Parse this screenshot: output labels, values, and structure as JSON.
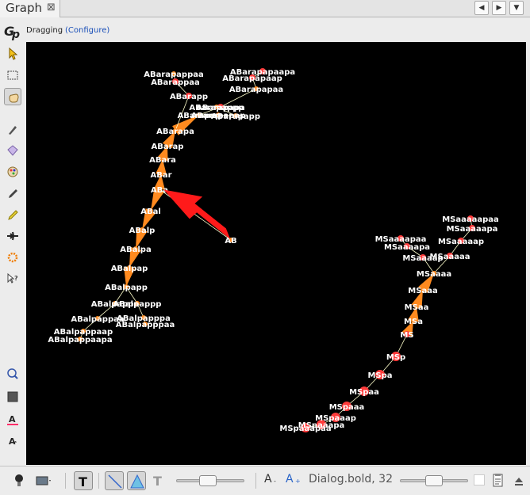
{
  "tab": {
    "title": "Graph",
    "close": "⊠"
  },
  "nav": {
    "back": "◀",
    "forward": "▶",
    "menu": "▼"
  },
  "status": {
    "mode": "Dragging",
    "configure": "(Configure)"
  },
  "font": {
    "label": "Dialog.bold, 32",
    "decrease": "A",
    "increase": "A"
  },
  "colors": {
    "canvas": "#000000",
    "edge_light": "#ffffcc",
    "node_red": "#ff3b3b",
    "node_orange": "#ff8a1f",
    "arrow": "#ff0000",
    "label": "#ffffff"
  },
  "graph": {
    "nodes": [
      {
        "id": "AB",
        "label": "AB"
      },
      {
        "id": "ABa",
        "label": "ABa"
      },
      {
        "id": "ABar",
        "label": "ABar"
      },
      {
        "id": "ABara",
        "label": "ABara"
      },
      {
        "id": "ABarap",
        "label": "ABarap"
      },
      {
        "id": "ABarapa",
        "label": "ABarapa"
      },
      {
        "id": "ABarapap",
        "label": "ABarapap"
      },
      {
        "id": "ABarapapa",
        "label": "ABarapapa"
      },
      {
        "id": "ABarapapp",
        "label": "ABarapapp"
      },
      {
        "id": "ABarapappaa",
        "label": "ABarapappaa"
      },
      {
        "id": "ABarappaa",
        "label": "ABarappaa"
      },
      {
        "id": "ABarapp",
        "label": "ABarapp"
      },
      {
        "id": "ABarapapaapa",
        "label": "ABarapapaapa"
      },
      {
        "id": "ABarapapaap",
        "label": "ABarapapaap"
      },
      {
        "id": "ABarapapaa",
        "label": "ABarapapaa"
      },
      {
        "id": "ABarapapap",
        "label": "ABarapapap"
      },
      {
        "id": "ABarappp",
        "label": "ABarapappp"
      },
      {
        "id": "ABal",
        "label": "ABal"
      },
      {
        "id": "ABalp",
        "label": "ABalp"
      },
      {
        "id": "ABalpa",
        "label": "ABalpa"
      },
      {
        "id": "ABalpap",
        "label": "ABalpap"
      },
      {
        "id": "ABalpapp",
        "label": "ABalpapp"
      },
      {
        "id": "ABalpappa",
        "label": "ABalpappa"
      },
      {
        "id": "ABalpappp",
        "label": "ABalpappp"
      },
      {
        "id": "ABalpappaa",
        "label": "ABalpappaa"
      },
      {
        "id": "ABalpapppa",
        "label": "ABalpapppa"
      },
      {
        "id": "ABalpappaap",
        "label": "ABalpappaap"
      },
      {
        "id": "ABalpapppaa",
        "label": "ABalpapppaa"
      },
      {
        "id": "ABalpappaapa",
        "label": "ABalpappaapa"
      },
      {
        "id": "MSaaaaapaa",
        "label": "MSaaaaapaa"
      },
      {
        "id": "MSaaaaapa",
        "label": "MSaaaaapa"
      },
      {
        "id": "MSaaaaap",
        "label": "MSaaaaap"
      },
      {
        "id": "MSaaaapaa",
        "label": "MSaaaapaa"
      },
      {
        "id": "MSaaaapa",
        "label": "MSaaaapa"
      },
      {
        "id": "MSaaaap",
        "label": "MSaaaap"
      },
      {
        "id": "MSaaaaa",
        "label": "MSaaaaa"
      },
      {
        "id": "MSaaaa",
        "label": "MSaaaa"
      },
      {
        "id": "MSaaa",
        "label": "MSaaa"
      },
      {
        "id": "MSaa",
        "label": "MSaa"
      },
      {
        "id": "MSa",
        "label": "MSa"
      },
      {
        "id": "MS",
        "label": "MS"
      },
      {
        "id": "MSp",
        "label": "MSp"
      },
      {
        "id": "MSpa",
        "label": "MSpa"
      },
      {
        "id": "MSpaa",
        "label": "MSpaa"
      },
      {
        "id": "MSpaaa",
        "label": "MSpaaa"
      },
      {
        "id": "MSpaaap",
        "label": "MSpaaap"
      },
      {
        "id": "MSpaaapa",
        "label": "MSpaaapa"
      },
      {
        "id": "MSpaaapaa",
        "label": "MSpaaapaa"
      }
    ]
  }
}
